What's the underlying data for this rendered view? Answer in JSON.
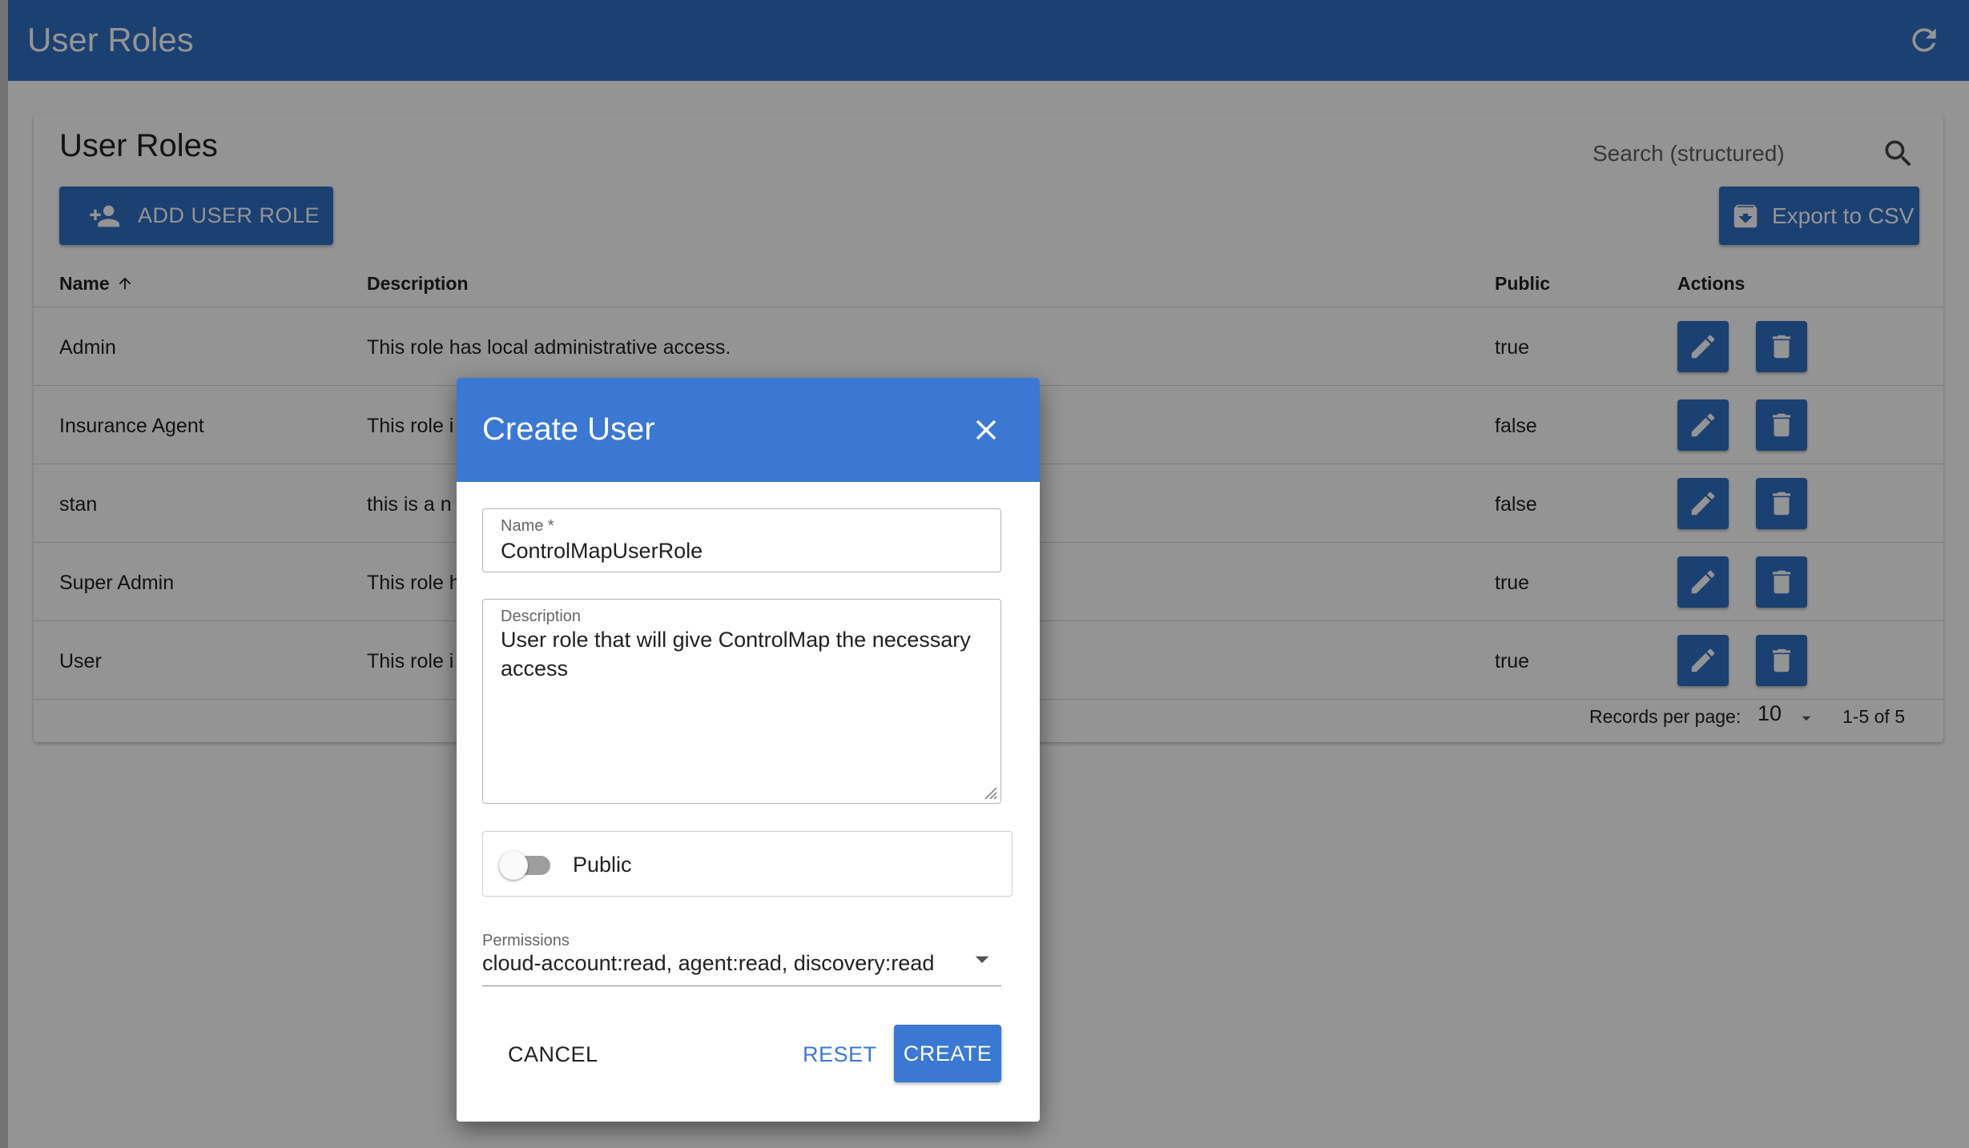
{
  "app": {
    "title": "User Roles"
  },
  "page": {
    "title": "User Roles",
    "search_placeholder": "Search (structured)",
    "add_label": "ADD USER ROLE",
    "export_label": "Export to CSV"
  },
  "table": {
    "headers": {
      "name": "Name",
      "description": "Description",
      "public": "Public",
      "actions": "Actions"
    },
    "rows": [
      {
        "name": "Admin",
        "description": "This role has local administrative access.",
        "public": "true"
      },
      {
        "name": "Insurance Agent",
        "description": "This role i",
        "public": "false"
      },
      {
        "name": "stan",
        "description": "this is a n",
        "public": "false"
      },
      {
        "name": "Super Admin",
        "description": "This role h",
        "public": "true"
      },
      {
        "name": "User",
        "description": "This role i",
        "public": "true"
      }
    ],
    "footer": {
      "records_label": "Records per page:",
      "per_page": "10",
      "range": "1-5 of 5"
    }
  },
  "dialog": {
    "title": "Create User",
    "name_label": "Name *",
    "name_value": "ControlMapUserRole",
    "description_label": "Description",
    "description_line1": "User role that will give ControlMap the necessary",
    "description_line2": "access",
    "public_label": "Public",
    "public_on": false,
    "permissions_label": "Permissions",
    "permissions_value": "cloud-account:read, agent:read, discovery:read",
    "cancel_label": "CANCEL",
    "reset_label": "RESET",
    "create_label": "CREATE"
  },
  "colors": {
    "primary": "#2f6ec4",
    "dialog_header": "#3a78d3"
  }
}
